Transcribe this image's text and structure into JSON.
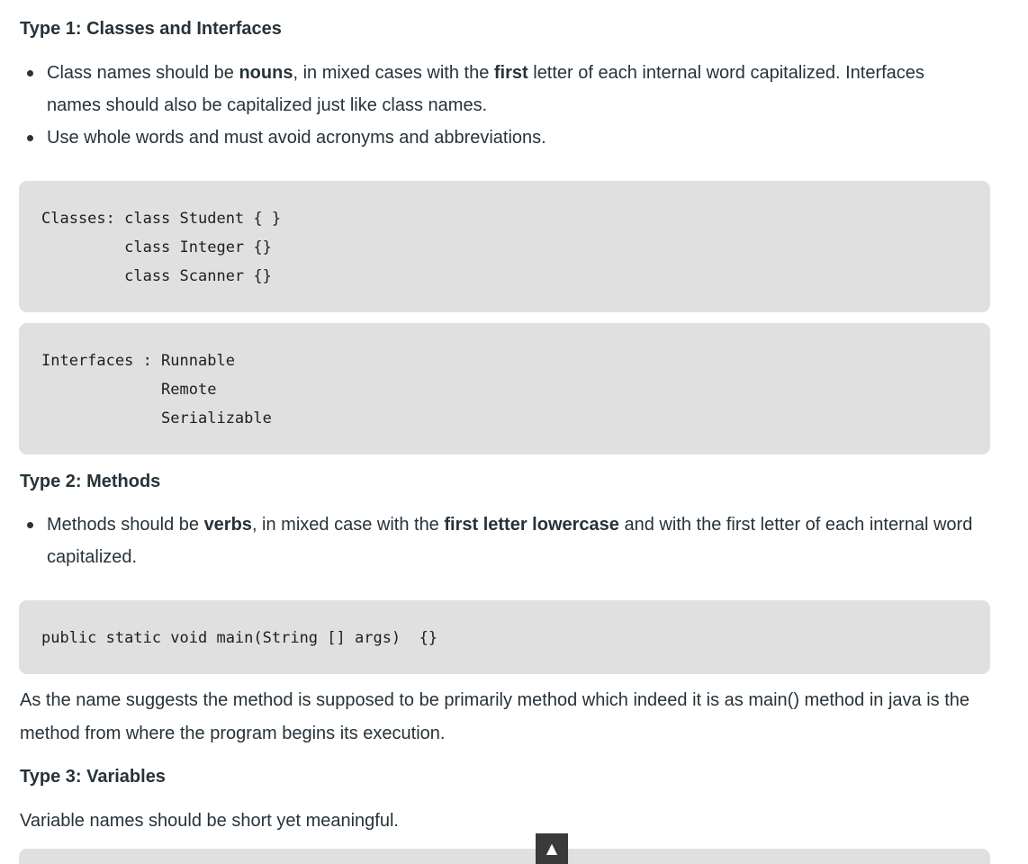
{
  "sections": {
    "type1": {
      "heading": "Type 1: Classes and Interfaces",
      "bullet1": {
        "a": "Class names should be ",
        "b1": "nouns",
        "c": ", in mixed cases with the ",
        "b2": "first",
        "d": " letter of each internal word capitalized. Interfaces names should also be capitalized just like class names."
      },
      "bullet2": "Use whole words and must avoid acronyms and abbreviations.",
      "code_classes": "Classes: class Student { }\n         class Integer {}\n         class Scanner {}",
      "code_interfaces": "Interfaces : Runnable\n             Remote\n             Serializable"
    },
    "type2": {
      "heading": "Type 2: Methods",
      "bullet1": {
        "a": "Methods should be ",
        "b1": "verbs",
        "c": ", in mixed case with the ",
        "b2": "first letter lowercase",
        "d": " and with the first letter of each internal word capitalized."
      },
      "code_main": "public static void main(String [] args)  {}",
      "paragraph": "As the name suggests the method is supposed to be primarily method which indeed it is as main() method in java is the method from where the program begins its execution."
    },
    "type3": {
      "heading": "Type 3: Variables",
      "paragraph": "Variable names should be short yet meaningful."
    }
  },
  "scroll_top": {
    "label": "▲"
  }
}
